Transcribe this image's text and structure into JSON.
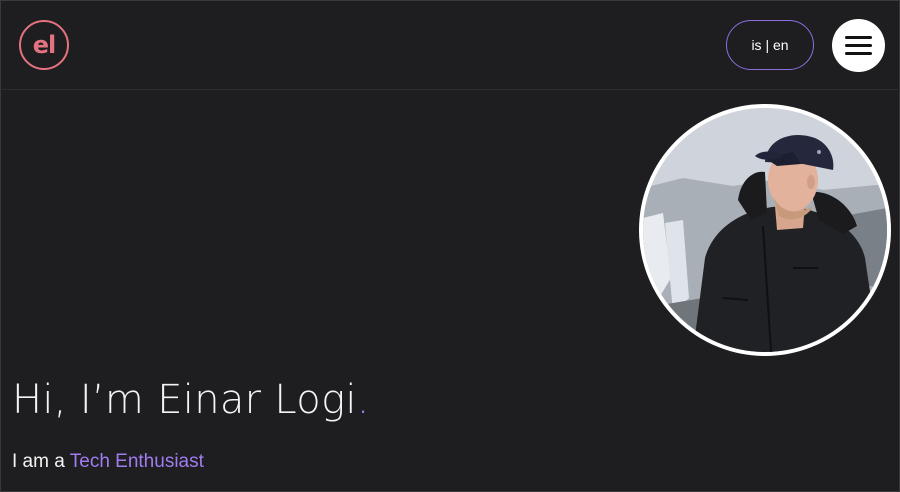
{
  "header": {
    "logo_text": "el",
    "language_switch": "is | en",
    "menu_icon": "hamburger-menu-icon"
  },
  "hero": {
    "avatar_icon": "profile-photo",
    "greeting": "Hi, I’m Einar Logi",
    "greeting_dot": ".",
    "intro_prefix": "I am a",
    "role": "Tech Enthusiast"
  },
  "colors": {
    "background": "#1e1d1f",
    "logo_accent": "#e2737f",
    "accent": "#a17cf0",
    "lang_border": "#8d6fe0",
    "text": "#f4f4f4"
  }
}
